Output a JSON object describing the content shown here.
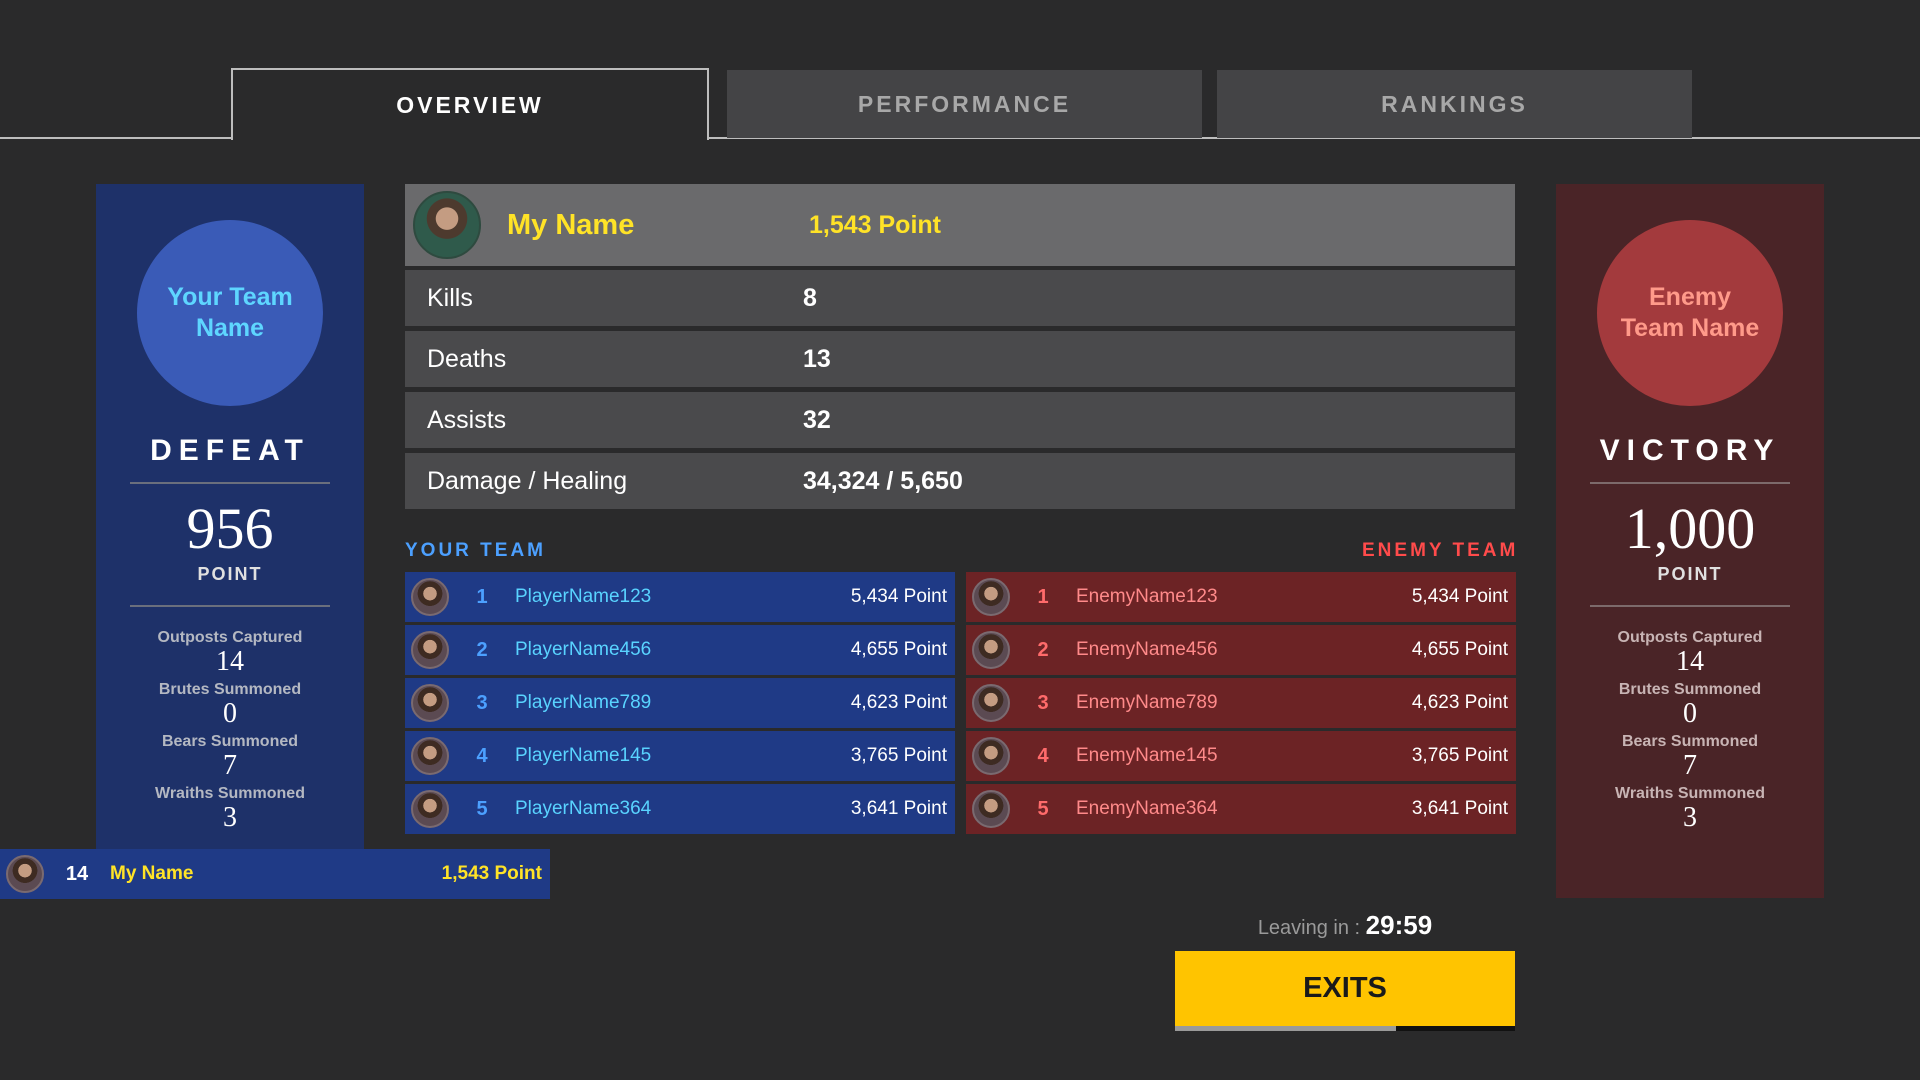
{
  "tabs": [
    {
      "label": "OVERVIEW",
      "active": true
    },
    {
      "label": "PERFORMANCE",
      "active": false
    },
    {
      "label": "RANKINGS",
      "active": false
    }
  ],
  "your_team": {
    "name": "Your Team Name",
    "result": "DEFEAT",
    "score": "956",
    "score_label": "POINT",
    "color": "#1e3169",
    "objectives": [
      {
        "label": "Outposts Captured",
        "value": "14"
      },
      {
        "label": "Brutes Summoned",
        "value": "0"
      },
      {
        "label": "Bears Summoned",
        "value": "7"
      },
      {
        "label": "Wraiths Summoned",
        "value": "3"
      }
    ]
  },
  "enemy_team": {
    "name": "Enemy Team Name",
    "result": "VICTORY",
    "score": "1,000",
    "score_label": "POINT",
    "color": "#4a2427",
    "objectives": [
      {
        "label": "Outposts Captured",
        "value": "14"
      },
      {
        "label": "Brutes Summoned",
        "value": "0"
      },
      {
        "label": "Bears Summoned",
        "value": "7"
      },
      {
        "label": "Wraiths Summoned",
        "value": "3"
      }
    ]
  },
  "me": {
    "name": "My Name",
    "points": "1,543 Point",
    "stats": [
      {
        "label": "Kills",
        "value": "8"
      },
      {
        "label": "Deaths",
        "value": "13"
      },
      {
        "label": "Assists",
        "value": "32"
      },
      {
        "label": "Damage / Healing",
        "value": "34,324 / 5,650"
      }
    ]
  },
  "your_team_list": {
    "title": "YOUR TEAM",
    "players": [
      {
        "rank": "1",
        "name": "PlayerName123",
        "points": "5,434 Point"
      },
      {
        "rank": "2",
        "name": "PlayerName456",
        "points": "4,655 Point"
      },
      {
        "rank": "3",
        "name": "PlayerName789",
        "points": "4,623 Point"
      },
      {
        "rank": "4",
        "name": "PlayerName145",
        "points": "3,765 Point"
      },
      {
        "rank": "5",
        "name": "PlayerName364",
        "points": "3,641 Point"
      }
    ],
    "me_row": {
      "rank": "14",
      "name": "My Name",
      "points": "1,543 Point"
    }
  },
  "enemy_team_list": {
    "title": "ENEMY TEAM",
    "players": [
      {
        "rank": "1",
        "name": "EnemyName123",
        "points": "5,434 Point"
      },
      {
        "rank": "2",
        "name": "EnemyName456",
        "points": "4,655 Point"
      },
      {
        "rank": "3",
        "name": "EnemyName789",
        "points": "4,623 Point"
      },
      {
        "rank": "4",
        "name": "EnemyName145",
        "points": "3,765 Point"
      },
      {
        "rank": "5",
        "name": "EnemyName364",
        "points": "3,641 Point"
      }
    ]
  },
  "exit": {
    "leaving_label": "Leaving in : ",
    "time": "29:59",
    "button_label": "EXITS",
    "progress": 0.65,
    "button_color": "#ffc400"
  },
  "icons": {
    "avatar": "player-portrait-icon"
  }
}
